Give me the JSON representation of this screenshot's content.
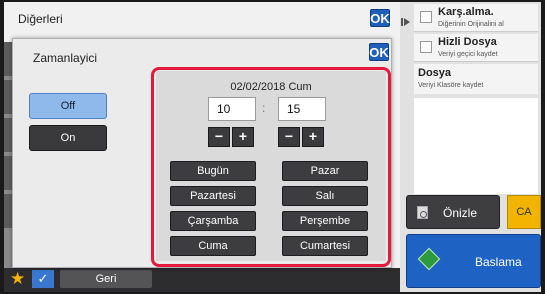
{
  "background": {
    "title": "Diğerleri",
    "ok_label": "OK"
  },
  "right_column": {
    "options": [
      {
        "title": "Karş.alma.",
        "subtitle": "Diğerinin Orijinalini al"
      },
      {
        "title": "Hizli Dosya",
        "subtitle": "Veriyi geçici kaydet"
      }
    ],
    "file_option": {
      "title": "Dosya",
      "subtitle": "Veriyi Klasöre kaydet"
    },
    "preview_label": "Önizle",
    "ca_label": "CA",
    "start_label": "Baslama"
  },
  "bottom_bar": {
    "back_label": "Geri",
    "star_icon": "star-icon",
    "check_icon": "checkmark-icon"
  },
  "dialog": {
    "title": "Zamanlayici",
    "ok_label": "OK",
    "off_label": "Off",
    "on_label": "On",
    "selected": "Off",
    "date_label": "02/02/2018  Cum",
    "hour_value": "10",
    "minute_value": "15",
    "colon": ":",
    "minus": "−",
    "plus": "+",
    "days": [
      "Bugün",
      "Pazar",
      "Pazartesi",
      "Salı",
      "Çarşamba",
      "Perşembe",
      "Cuma",
      "Cumartesi"
    ],
    "highlight_color": "#e4193b"
  },
  "colors": {
    "accent_blue": "#1e63c4",
    "off_selected": "#8fb9ea",
    "ca_yellow": "#f2b400"
  }
}
